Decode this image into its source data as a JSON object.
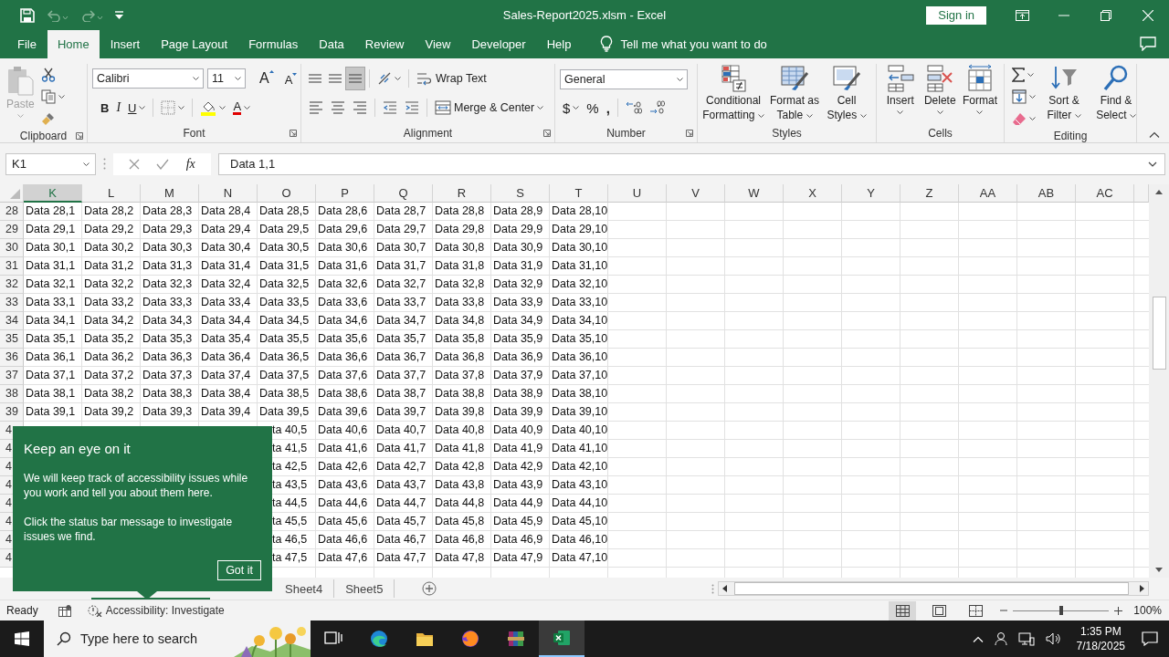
{
  "window": {
    "title": "Sales-Report2025.xlsm - Excel",
    "sign_in": "Sign in"
  },
  "menu_tabs": [
    {
      "label": "File",
      "selected": false
    },
    {
      "label": "Home",
      "selected": true
    },
    {
      "label": "Insert",
      "selected": false
    },
    {
      "label": "Page Layout",
      "selected": false
    },
    {
      "label": "Formulas",
      "selected": false
    },
    {
      "label": "Data",
      "selected": false
    },
    {
      "label": "Review",
      "selected": false
    },
    {
      "label": "View",
      "selected": false
    },
    {
      "label": "Developer",
      "selected": false
    },
    {
      "label": "Help",
      "selected": false
    }
  ],
  "tell_me": {
    "placeholder": "Tell me what you want to do"
  },
  "ribbon": {
    "clipboard": {
      "label": "Clipboard",
      "paste": {
        "label": "Paste",
        "disabled": true
      }
    },
    "font": {
      "label": "Font",
      "name": "Calibri",
      "size": "11",
      "grow": "A",
      "shrink": "A",
      "bold": "B",
      "italic": "I",
      "underline": "U",
      "color_letter": "A"
    },
    "alignment": {
      "label": "Alignment",
      "vertical": [
        {
          "selected": false
        },
        {
          "selected": false
        },
        {
          "selected": true
        }
      ],
      "wrap": "Wrap Text",
      "merge": "Merge & Center"
    },
    "number": {
      "label": "Number",
      "format": "General",
      "currency": "$",
      "percent": "%",
      "comma": ","
    },
    "styles": {
      "label": "Styles",
      "buttons": [
        "Conditional Formatting",
        "Format as Table",
        "Cell Styles"
      ]
    },
    "cells": {
      "label": "Cells",
      "buttons": [
        "Insert",
        "Delete",
        "Format"
      ]
    },
    "editing": {
      "label": "Editing",
      "buttons": [
        "Sort & Filter",
        "Find & Select"
      ]
    }
  },
  "formula_bar": {
    "name_box": "K1",
    "fx": "fx",
    "formula": "Data 1,1"
  },
  "columns": [
    {
      "label": "K",
      "selected": true
    },
    {
      "label": "L",
      "selected": false
    },
    {
      "label": "M",
      "selected": false
    },
    {
      "label": "N",
      "selected": false
    },
    {
      "label": "O",
      "selected": false
    },
    {
      "label": "P",
      "selected": false
    },
    {
      "label": "Q",
      "selected": false
    },
    {
      "label": "R",
      "selected": false
    },
    {
      "label": "S",
      "selected": false
    },
    {
      "label": "T",
      "selected": false
    },
    {
      "label": "U",
      "selected": false
    },
    {
      "label": "V",
      "selected": false
    },
    {
      "label": "W",
      "selected": false
    },
    {
      "label": "X",
      "selected": false
    },
    {
      "label": "Y",
      "selected": false
    },
    {
      "label": "Z",
      "selected": false
    },
    {
      "label": "AA",
      "selected": false
    },
    {
      "label": "AB",
      "selected": false
    },
    {
      "label": "AC",
      "selected": false
    }
  ],
  "rows": [
    {
      "label": "28",
      "cells": [
        "Data 28,1",
        "Data 28,2",
        "Data 28,3",
        "Data 28,4",
        "Data 28,5",
        "Data 28,6",
        "Data 28,7",
        "Data 28,8",
        "Data 28,9",
        "Data 28,10"
      ]
    },
    {
      "label": "29",
      "cells": [
        "Data 29,1",
        "Data 29,2",
        "Data 29,3",
        "Data 29,4",
        "Data 29,5",
        "Data 29,6",
        "Data 29,7",
        "Data 29,8",
        "Data 29,9",
        "Data 29,10"
      ]
    },
    {
      "label": "30",
      "cells": [
        "Data 30,1",
        "Data 30,2",
        "Data 30,3",
        "Data 30,4",
        "Data 30,5",
        "Data 30,6",
        "Data 30,7",
        "Data 30,8",
        "Data 30,9",
        "Data 30,10"
      ]
    },
    {
      "label": "31",
      "cells": [
        "Data 31,1",
        "Data 31,2",
        "Data 31,3",
        "Data 31,4",
        "Data 31,5",
        "Data 31,6",
        "Data 31,7",
        "Data 31,8",
        "Data 31,9",
        "Data 31,10"
      ]
    },
    {
      "label": "32",
      "cells": [
        "Data 32,1",
        "Data 32,2",
        "Data 32,3",
        "Data 32,4",
        "Data 32,5",
        "Data 32,6",
        "Data 32,7",
        "Data 32,8",
        "Data 32,9",
        "Data 32,10"
      ]
    },
    {
      "label": "33",
      "cells": [
        "Data 33,1",
        "Data 33,2",
        "Data 33,3",
        "Data 33,4",
        "Data 33,5",
        "Data 33,6",
        "Data 33,7",
        "Data 33,8",
        "Data 33,9",
        "Data 33,10"
      ]
    },
    {
      "label": "34",
      "cells": [
        "Data 34,1",
        "Data 34,2",
        "Data 34,3",
        "Data 34,4",
        "Data 34,5",
        "Data 34,6",
        "Data 34,7",
        "Data 34,8",
        "Data 34,9",
        "Data 34,10"
      ]
    },
    {
      "label": "35",
      "cells": [
        "Data 35,1",
        "Data 35,2",
        "Data 35,3",
        "Data 35,4",
        "Data 35,5",
        "Data 35,6",
        "Data 35,7",
        "Data 35,8",
        "Data 35,9",
        "Data 35,10"
      ]
    },
    {
      "label": "36",
      "cells": [
        "Data 36,1",
        "Data 36,2",
        "Data 36,3",
        "Data 36,4",
        "Data 36,5",
        "Data 36,6",
        "Data 36,7",
        "Data 36,8",
        "Data 36,9",
        "Data 36,10"
      ]
    },
    {
      "label": "37",
      "cells": [
        "Data 37,1",
        "Data 37,2",
        "Data 37,3",
        "Data 37,4",
        "Data 37,5",
        "Data 37,6",
        "Data 37,7",
        "Data 37,8",
        "Data 37,9",
        "Data 37,10"
      ]
    },
    {
      "label": "38",
      "cells": [
        "Data 38,1",
        "Data 38,2",
        "Data 38,3",
        "Data 38,4",
        "Data 38,5",
        "Data 38,6",
        "Data 38,7",
        "Data 38,8",
        "Data 38,9",
        "Data 38,10"
      ]
    },
    {
      "label": "39",
      "cells": [
        "Data 39,1",
        "Data 39,2",
        "Data 39,3",
        "Data 39,4",
        "Data 39,5",
        "Data 39,6",
        "Data 39,7",
        "Data 39,8",
        "Data 39,9",
        "Data 39,10"
      ]
    },
    {
      "label": "4",
      "cells": [
        null,
        null,
        null,
        null,
        "ta 40,5",
        "Data 40,6",
        "Data 40,7",
        "Data 40,8",
        "Data 40,9",
        "Data 40,10"
      ]
    },
    {
      "label": "4",
      "cells": [
        null,
        null,
        null,
        null,
        "ta 41,5",
        "Data 41,6",
        "Data 41,7",
        "Data 41,8",
        "Data 41,9",
        "Data 41,10"
      ]
    },
    {
      "label": "4",
      "cells": [
        null,
        null,
        null,
        null,
        "ta 42,5",
        "Data 42,6",
        "Data 42,7",
        "Data 42,8",
        "Data 42,9",
        "Data 42,10"
      ]
    },
    {
      "label": "4",
      "cells": [
        null,
        null,
        null,
        null,
        "ta 43,5",
        "Data 43,6",
        "Data 43,7",
        "Data 43,8",
        "Data 43,9",
        "Data 43,10"
      ]
    },
    {
      "label": "4",
      "cells": [
        null,
        null,
        null,
        null,
        "ta 44,5",
        "Data 44,6",
        "Data 44,7",
        "Data 44,8",
        "Data 44,9",
        "Data 44,10"
      ]
    },
    {
      "label": "4",
      "cells": [
        null,
        null,
        null,
        null,
        "ta 45,5",
        "Data 45,6",
        "Data 45,7",
        "Data 45,8",
        "Data 45,9",
        "Data 45,10"
      ]
    },
    {
      "label": "4",
      "cells": [
        null,
        null,
        null,
        null,
        "ta 46,5",
        "Data 46,6",
        "Data 46,7",
        "Data 46,8",
        "Data 46,9",
        "Data 46,10"
      ]
    },
    {
      "label": "4",
      "cells": [
        null,
        null,
        null,
        null,
        "ta 47,5",
        "Data 47,6",
        "Data 47,7",
        "Data 47,8",
        "Data 47,9",
        "Data 47,10"
      ]
    }
  ],
  "sheets": [
    {
      "label": "Sheet4",
      "selected": false
    },
    {
      "label": "Sheet5",
      "selected": false
    }
  ],
  "popup": {
    "title": "Keep an eye on it",
    "paragraphs": [
      "We will keep track of accessibility issues while you work and tell you about them here.",
      "Click the status bar message to investigate issues we find."
    ],
    "button": "Got it"
  },
  "status": {
    "ready": "Ready",
    "accessibility": "Accessibility: Investigate",
    "views": [
      {
        "selected": true
      },
      {
        "selected": false
      },
      {
        "selected": false
      }
    ],
    "zoom": {
      "level": 0.5
    },
    "zoom_text": "100%"
  },
  "taskbar": {
    "search": {
      "placeholder": "Type here to search"
    },
    "apps": [
      {
        "kind": "taskview",
        "selected": false
      },
      {
        "kind": "edge",
        "selected": false
      },
      {
        "kind": "explorer",
        "selected": false
      },
      {
        "kind": "firefox",
        "selected": false
      },
      {
        "kind": "winrar",
        "selected": false
      },
      {
        "kind": "excel",
        "selected": true
      }
    ],
    "time": "1:35 PM",
    "date": "7/18/2025"
  }
}
